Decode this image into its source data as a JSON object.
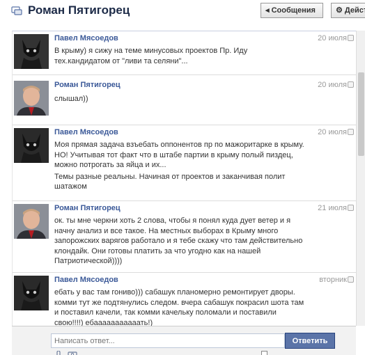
{
  "header": {
    "title": "Роман Пятигорец",
    "messages_button": "◂ Сообщения",
    "actions_button": "⚙ Действ"
  },
  "messages": [
    {
      "author": "Павел Мясоедов",
      "time": "20 июля",
      "avatar": "black-cat-avatar",
      "paragraphs": [
        "В крыму) я сижу на теме минусовых проектов Пр. Иду тех.кандидатом от \"ливи та селяни\"..."
      ]
    },
    {
      "author": "Роман Пятигорец",
      "time": "20 июля",
      "avatar": "man-portrait-avatar",
      "paragraphs": [
        "слышал))"
      ]
    },
    {
      "author": "Павел Мясоедов",
      "time": "20 июля",
      "avatar": "black-cat-avatar",
      "paragraphs": [
        "Моя прямая задача взъебать оппонентов пр по мажоритарке в крыму. НО! Учитывая тот факт что в штабе партии в крыму полый пиздец, можно потрогать за яйца и их...",
        "Темы разные реальны. Начиная от проектов и заканчивая полит шатажом"
      ]
    },
    {
      "author": "Роман Пятигорец",
      "time": "21 июля",
      "avatar": "man-portrait-avatar",
      "paragraphs": [
        "ок. ты мне черкни хоть 2 слова, чтобы я понял куда дует ветер и я начну анализ и все такое. На местных выборах в Крыму много запорожских варягов работало и я тебе скажу что там действительно клондайк. Они готовы платить за что угодно как на нашей Патриотической))))"
      ]
    },
    {
      "author": "Павел Мясоедов",
      "time": "вторник",
      "avatar": "black-cat-avatar",
      "paragraphs": [
        "ебать у вас там гониво))) сабашук планомерно ремонтирует дворы. комми тут же подтянулись следом. вчера сабашук покрасил шота там и поставил качели, так комми качельку поломали и поставили свою!!!!) ебааааааааааать!)"
      ]
    }
  ],
  "reply": {
    "placeholder": "Написать ответ...",
    "send_label": "Ответить"
  }
}
